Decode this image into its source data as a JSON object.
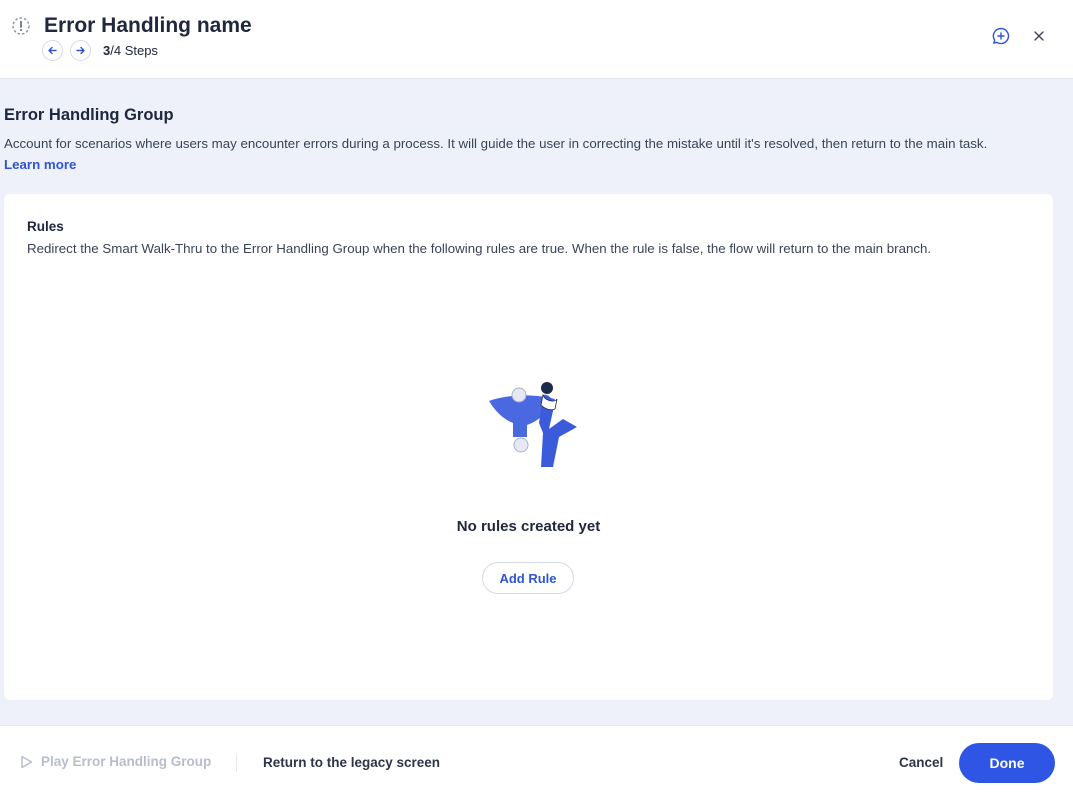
{
  "header": {
    "title": "Error Handling name",
    "steps_current": "3",
    "steps_rest": "/4 Steps"
  },
  "section": {
    "title": "Error Handling Group",
    "description": "Account for scenarios where users may encounter errors during a process. It will guide the user in correcting the mistake until it's resolved, then return to the main task.",
    "learn_more": "Learn more"
  },
  "rules": {
    "title": "Rules",
    "description": "Redirect the Smart Walk-Thru to the Error Handling Group when the following rules are true. When the rule is false, the flow will return to the main branch.",
    "empty_text": "No rules created yet",
    "add_rule_label": "Add Rule"
  },
  "footer": {
    "play_label": "Play Error Handling Group",
    "legacy_label": "Return to the legacy screen",
    "cancel_label": "Cancel",
    "done_label": "Done"
  },
  "icons": {
    "step_type": "error-handling-icon",
    "prev": "arrow-left-icon",
    "next": "arrow-right-icon",
    "comment": "add-comment-icon",
    "close": "close-icon",
    "play": "play-icon"
  },
  "colors": {
    "accent": "#2f55e4",
    "link": "#2f55d4",
    "background": "#eef1f9",
    "disabled_text": "#b7bdcc"
  }
}
